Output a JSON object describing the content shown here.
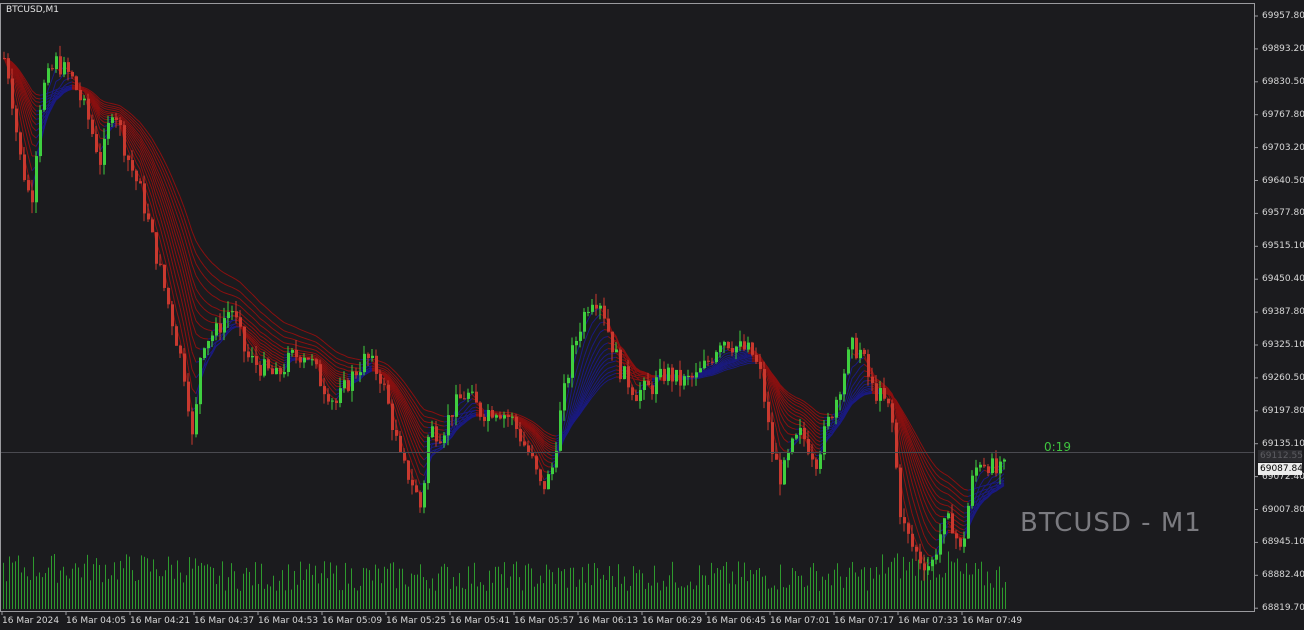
{
  "window": {
    "symbol_title": "BTCUSD,M1",
    "watermark": "BTCUSD - M1",
    "countdown": "0:19"
  },
  "price_axis": {
    "labels": [
      "69957.80",
      "69893.20",
      "69830.50",
      "69767.80",
      "69703.20",
      "69640.50",
      "69577.80",
      "69515.10",
      "69450.40",
      "69387.80",
      "69325.10",
      "69260.50",
      "69197.80",
      "69135.10",
      "69072.40",
      "69007.80",
      "68945.10",
      "68882.40",
      "68819.70"
    ],
    "current_price": "69087.84",
    "bid_line_price": "69112.55"
  },
  "time_axis": {
    "labels": [
      "16 Mar 2024",
      "16 Mar 04:05",
      "16 Mar 04:21",
      "16 Mar 04:37",
      "16 Mar 04:53",
      "16 Mar 05:09",
      "16 Mar 05:25",
      "16 Mar 05:41",
      "16 Mar 05:57",
      "16 Mar 06:13",
      "16 Mar 06:29",
      "16 Mar 06:45",
      "16 Mar 07:01",
      "16 Mar 07:17",
      "16 Mar 07:33",
      "16 Mar 07:49"
    ]
  },
  "colors": {
    "background": "#1b1b1e",
    "bull": "#3fcf3f",
    "bear": "#c8392f",
    "ribbon_bear": "#8a1010",
    "ribbon_bull": "#1a1a80",
    "volume": "#2e9a2e",
    "axis_text": "#d8d8d8",
    "grid_line": "#3a3a3e"
  },
  "chart_data": {
    "type": "candlestick",
    "ylim": [
      68805,
      69970
    ],
    "price_path_key": [
      [
        0,
        69910
      ],
      [
        8,
        69850
      ],
      [
        18,
        69700
      ],
      [
        30,
        69600
      ],
      [
        40,
        69820
      ],
      [
        55,
        69880
      ],
      [
        70,
        69850
      ],
      [
        85,
        69780
      ],
      [
        100,
        69680
      ],
      [
        112,
        69800
      ],
      [
        125,
        69700
      ],
      [
        140,
        69620
      ],
      [
        155,
        69500
      ],
      [
        170,
        69380
      ],
      [
        185,
        69250
      ],
      [
        192,
        69120
      ],
      [
        200,
        69330
      ],
      [
        215,
        69350
      ],
      [
        230,
        69400
      ],
      [
        245,
        69300
      ],
      [
        260,
        69280
      ],
      [
        275,
        69260
      ],
      [
        290,
        69300
      ],
      [
        305,
        69310
      ],
      [
        320,
        69250
      ],
      [
        335,
        69210
      ],
      [
        350,
        69260
      ],
      [
        365,
        69300
      ],
      [
        380,
        69260
      ],
      [
        390,
        69180
      ],
      [
        400,
        69090
      ],
      [
        410,
        69060
      ],
      [
        420,
        69000
      ],
      [
        428,
        69160
      ],
      [
        440,
        69150
      ],
      [
        452,
        69200
      ],
      [
        465,
        69230
      ],
      [
        480,
        69190
      ],
      [
        495,
        69200
      ],
      [
        510,
        69180
      ],
      [
        520,
        69140
      ],
      [
        530,
        69100
      ],
      [
        540,
        69040
      ],
      [
        550,
        69070
      ],
      [
        560,
        69200
      ],
      [
        570,
        69300
      ],
      [
        580,
        69370
      ],
      [
        590,
        69420
      ],
      [
        600,
        69410
      ],
      [
        610,
        69330
      ],
      [
        620,
        69270
      ],
      [
        635,
        69230
      ],
      [
        650,
        69240
      ],
      [
        665,
        69270
      ],
      [
        680,
        69250
      ],
      [
        695,
        69260
      ],
      [
        710,
        69300
      ],
      [
        720,
        69340
      ],
      [
        735,
        69320
      ],
      [
        750,
        69310
      ],
      [
        760,
        69260
      ],
      [
        770,
        69120
      ],
      [
        780,
        69060
      ],
      [
        790,
        69120
      ],
      [
        800,
        69150
      ],
      [
        815,
        69100
      ],
      [
        825,
        69160
      ],
      [
        835,
        69220
      ],
      [
        850,
        69320
      ],
      [
        860,
        69310
      ],
      [
        870,
        69240
      ],
      [
        880,
        69220
      ],
      [
        890,
        69190
      ],
      [
        895,
        69080
      ],
      [
        900,
        68980
      ],
      [
        910,
        68930
      ],
      [
        920,
        68900
      ],
      [
        930,
        68890
      ],
      [
        940,
        68960
      ],
      [
        950,
        68980
      ],
      [
        960,
        68910
      ],
      [
        970,
        69050
      ],
      [
        978,
        69100
      ],
      [
        988,
        69090
      ],
      [
        996,
        69070
      ],
      [
        1006,
        69087
      ]
    ]
  }
}
